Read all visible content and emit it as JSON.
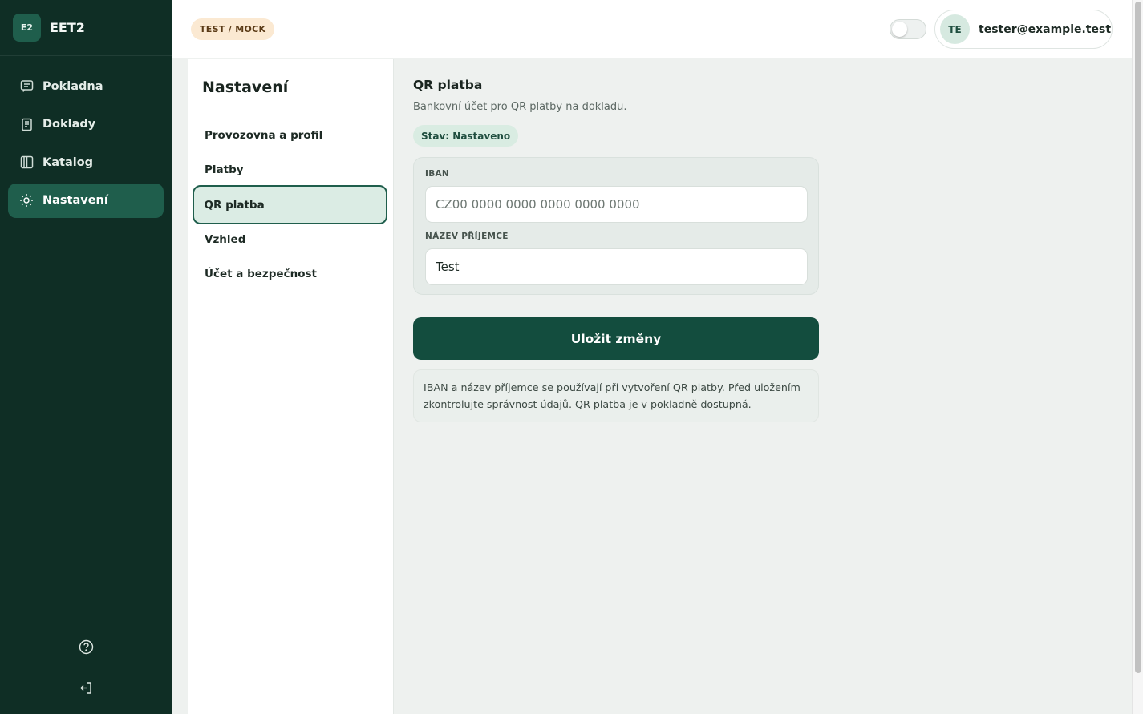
{
  "brand": {
    "badge": "E2",
    "name": "EET2"
  },
  "sidebar": {
    "items": [
      {
        "label": "Pokladna",
        "icon": "receipt-icon",
        "active": false
      },
      {
        "label": "Doklady",
        "icon": "document-icon",
        "active": false
      },
      {
        "label": "Katalog",
        "icon": "book-icon",
        "active": false
      },
      {
        "label": "Nastavení",
        "icon": "sun-settings-icon",
        "active": true
      }
    ],
    "bottom_icons": [
      "help-icon",
      "logout-icon"
    ]
  },
  "topbar": {
    "env_badge": "TEST / MOCK",
    "theme_toggle_on": false,
    "user": {
      "initials": "TE",
      "email": "tester@example.test"
    }
  },
  "settings": {
    "title": "Nastavení",
    "items": [
      {
        "label": "Provozovna a profil",
        "active": false
      },
      {
        "label": "Platby",
        "active": false
      },
      {
        "label": "QR platba",
        "active": true
      },
      {
        "label": "Vzhled",
        "active": false
      },
      {
        "label": "Účet a bezpečnost",
        "active": false
      }
    ]
  },
  "main": {
    "title": "QR platba",
    "subtitle": "Bankovní účet pro QR platby na dokladu.",
    "status": "Stav: Nastaveno",
    "iban": {
      "label": "IBAN",
      "value": "",
      "placeholder": "CZ00 0000 0000 0000 0000 0000"
    },
    "recipient": {
      "label": "NÁZEV PŘÍJEMCE",
      "value": "Test",
      "placeholder": ""
    },
    "save_label": "Uložit změny",
    "info_text": "IBAN a název příjemce se používají při vytvoření QR platby. Před uložením zkontrolujte správnost údajů. QR platba je v pokladně dostupná."
  },
  "colors": {
    "sidebar_bg": "#0f2e25",
    "accent": "#1f5e4c",
    "button_bg": "#134d3e",
    "env_badge_bg": "#fbe9d2",
    "status_badge_bg": "#d9ece2"
  }
}
